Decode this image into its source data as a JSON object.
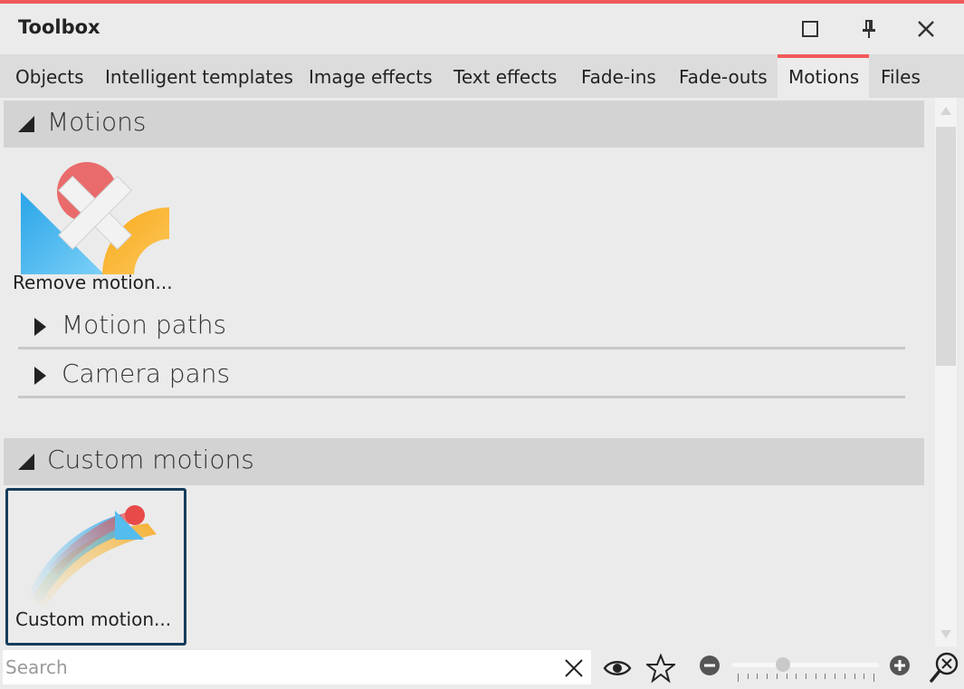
{
  "colors": {
    "accent": "#f25a5a",
    "selection_border": "#163d5c"
  },
  "window": {
    "title": "Toolbox",
    "buttons": [
      "maximize-icon",
      "pin-icon",
      "close-icon"
    ]
  },
  "tabs": [
    {
      "label": "Objects",
      "active": false
    },
    {
      "label": "Intelligent templates",
      "active": false
    },
    {
      "label": "Image effects",
      "active": false
    },
    {
      "label": "Text effects",
      "active": false
    },
    {
      "label": "Fade-ins",
      "active": false
    },
    {
      "label": "Fade-outs",
      "active": false
    },
    {
      "label": "Motions",
      "active": true
    },
    {
      "label": "Files",
      "active": false
    }
  ],
  "sections": {
    "motions": {
      "label": "Motions",
      "expanded": true,
      "items": [
        {
          "caption": "Remove motion...",
          "icon": "remove-motion-icon"
        }
      ],
      "subgroups": [
        {
          "label": "Motion paths",
          "expanded": false
        },
        {
          "label": "Camera pans",
          "expanded": false
        }
      ]
    },
    "custom_motions": {
      "label": "Custom motions",
      "expanded": true,
      "items": [
        {
          "caption": "Custom motion...",
          "icon": "custom-motion-icon",
          "selected": true
        }
      ]
    }
  },
  "bottombar": {
    "search_placeholder": "Search",
    "search_value": "",
    "icons": [
      "clear-search-icon",
      "eye-icon",
      "star-icon",
      "zoom-out-icon",
      "zoom-in-icon",
      "zoom-reset-icon"
    ],
    "zoom_level": 0.33
  }
}
